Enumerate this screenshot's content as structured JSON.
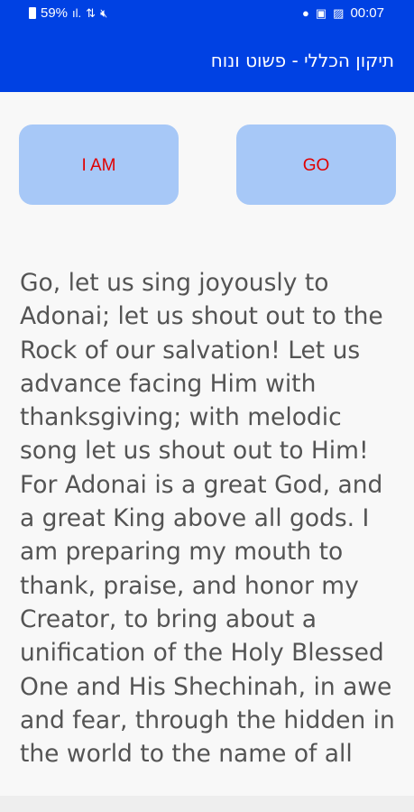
{
  "status_bar": {
    "battery": "59%",
    "time": "00:07"
  },
  "app_bar": {
    "title": "תיקון הכללי - פשוט ונוח"
  },
  "buttons": {
    "i_am": "I AM",
    "go": "GO"
  },
  "main_text": "Go, let us sing joyously to Adonai; let us shout out to the Rock of our salvation! Let us advance facing Him with thanksgiving; with melodic song let us shout out to Him! For Adonai is a great God, and a great King above all gods. I am preparing my mouth to thank, praise, and honor my Creator, to bring about a unification of the Holy Blessed One and His Shechinah, in awe and fear, through the hidden in the world to the name of all Israel.",
  "colors": {
    "accent": "#0041e3",
    "button_bg": "#a7c8f7",
    "button_text": "#e00000",
    "body_text": "#545454"
  }
}
